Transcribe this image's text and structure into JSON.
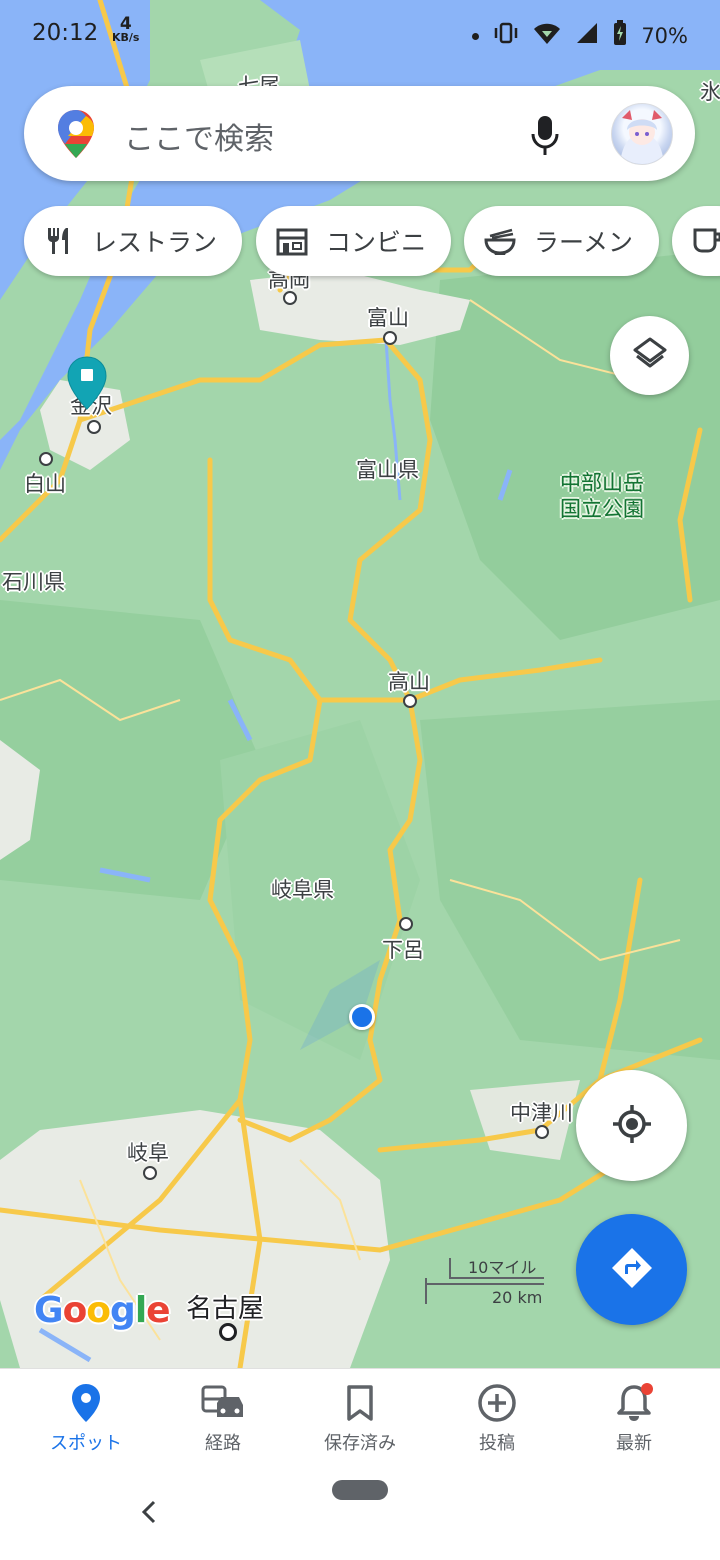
{
  "status_bar": {
    "time": "20:12",
    "speed_value": "4",
    "speed_unit": "KB/s",
    "battery": "70%"
  },
  "search": {
    "placeholder": "ここで検索"
  },
  "chips": [
    {
      "label": "レストラン",
      "icon": "restaurant-icon"
    },
    {
      "label": "コンビニ",
      "icon": "convenience-store-icon"
    },
    {
      "label": "ラーメン",
      "icon": "ramen-icon"
    },
    {
      "label": "",
      "icon": "cafe-icon"
    }
  ],
  "map_labels": {
    "nanao": "七尾",
    "himi_fragment": "氷",
    "takaoka": "高岡",
    "toyama": "富山",
    "kanazawa": "金沢",
    "hakusan": "白山",
    "toyama_pref": "富山県",
    "chubu_park_line1": "中部山岳",
    "chubu_park_line2": "国立公園",
    "ishikawa_pref": "石川県",
    "takayama": "高山",
    "gifu_pref": "岐阜県",
    "gero": "下呂",
    "nakatsugawa": "中津川",
    "gifu": "岐阜",
    "nagoya": "名古屋"
  },
  "scale": {
    "mile": "10マイル",
    "km": "20 km"
  },
  "google_logo": "Google",
  "colors": {
    "accent": "#1a73e8",
    "map_green": "#9dd3a7",
    "water": "#8ab4f8",
    "road": "#f9d66f"
  },
  "bottom_nav": [
    {
      "label": "スポット",
      "icon": "location-pin-icon",
      "active": true
    },
    {
      "label": "経路",
      "icon": "commute-icon",
      "active": false
    },
    {
      "label": "保存済み",
      "icon": "bookmark-icon",
      "active": false
    },
    {
      "label": "投稿",
      "icon": "add-circle-icon",
      "active": false
    },
    {
      "label": "最新",
      "icon": "notification-bell-icon",
      "active": false
    }
  ]
}
